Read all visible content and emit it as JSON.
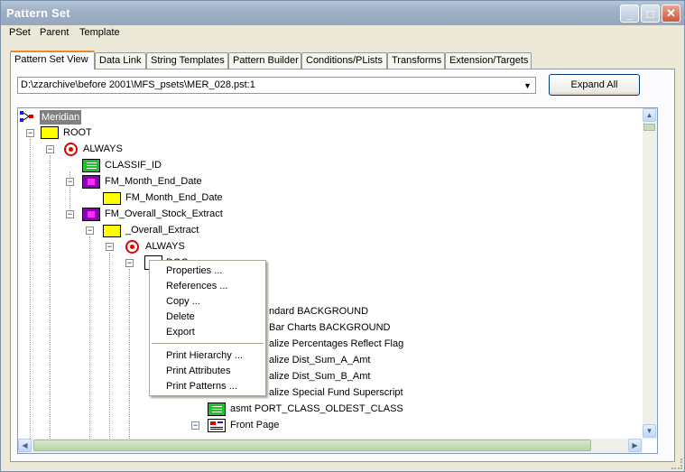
{
  "window": {
    "title": "Pattern Set"
  },
  "menu": [
    "PSet",
    "Parent",
    "Template"
  ],
  "tabs": [
    "Pattern Set View",
    "Data Link",
    "String Templates",
    "Pattern Builder",
    "Conditions/PLists",
    "Transforms",
    "Extension/Targets"
  ],
  "active_tab": "Pattern Set View",
  "path_combo": {
    "value": "D:\\zzarchive\\before 2001\\MFS_psets\\MER_028.pst:1"
  },
  "expand_all_label": "Expand All",
  "tree": {
    "root_label": "Meridian",
    "nodes": [
      {
        "label": "ROOT",
        "icon": "folder-icon"
      },
      {
        "label": "ALWAYS",
        "icon": "target-icon"
      },
      {
        "label": "CLASSIF_ID",
        "icon": "list-icon"
      },
      {
        "label": "FM_Month_End_Date",
        "icon": "magenta-icon"
      },
      {
        "label": "FM_Month_End_Date",
        "icon": "folder-icon"
      },
      {
        "label": "FM_Overall_Stock_Extract",
        "icon": "magenta-icon"
      },
      {
        "label": "_Overall_Extract",
        "icon": "folder-icon"
      },
      {
        "label": "ALWAYS",
        "icon": "target-icon"
      },
      {
        "label": "DOC",
        "icon": "doc-icon"
      },
      {
        "label": "ndard BACKGROUND",
        "icon": ""
      },
      {
        "label": "Bar Charts BACKGROUND",
        "icon": ""
      },
      {
        "label": "alize Percentages Reflect Flag",
        "icon": ""
      },
      {
        "label": "alize Dist_Sum_A_Amt",
        "icon": ""
      },
      {
        "label": "alize Dist_Sum_B_Amt",
        "icon": ""
      },
      {
        "label": "alize Special Fund Superscript",
        "icon": ""
      },
      {
        "label": "asmt PORT_CLASS_OLDEST_CLASS",
        "icon": "list-icon"
      },
      {
        "label": "Front Page",
        "icon": "page-icon"
      }
    ]
  },
  "context_menu": {
    "group1": [
      "Properties ...",
      "References ...",
      "Copy ...",
      "Delete",
      "Export"
    ],
    "group2": [
      "Print Hierarchy ...",
      "Print Attributes",
      "Print Patterns ..."
    ]
  },
  "colors": {
    "accent_tab": "#E68B2C",
    "folder": "#FFFF00",
    "target": "#E00000",
    "list": "#22C02A",
    "magenta": "#8E00B6"
  }
}
